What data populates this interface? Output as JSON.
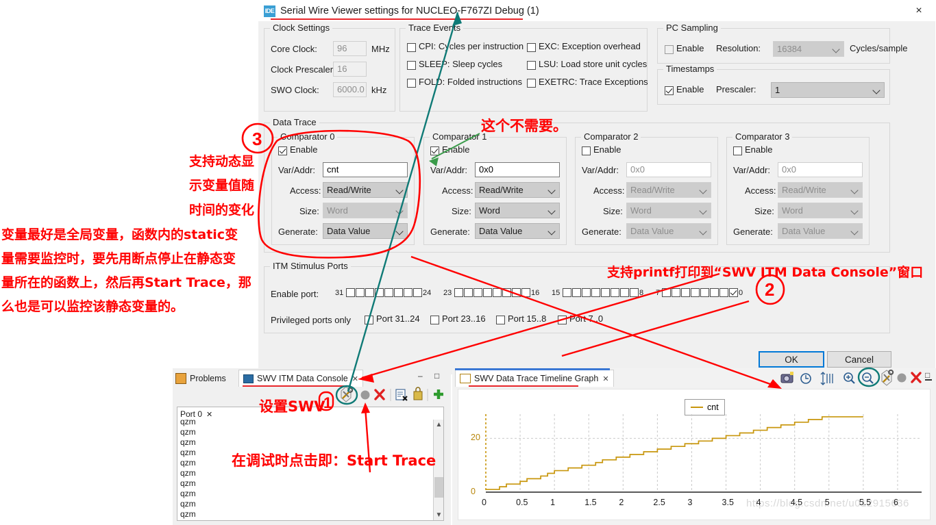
{
  "dialog": {
    "title": "Serial Wire Viewer settings for NUCLEO-F767ZI Debug (1)",
    "logo": "IDE",
    "close_icon": "×",
    "clock_settings": {
      "legend": "Clock Settings",
      "core_clock_label": "Core Clock:",
      "core_clock_value": "96",
      "core_clock_unit": "MHz",
      "prescaler_label": "Clock Prescaler:",
      "prescaler_value": "16",
      "swo_label": "SWO Clock:",
      "swo_value": "6000.0",
      "swo_unit": "kHz"
    },
    "trace_events": {
      "legend": "Trace Events",
      "items": [
        {
          "label": "CPI: Cycles per instruction",
          "checked": false
        },
        {
          "label": "SLEEP: Sleep cycles",
          "checked": false
        },
        {
          "label": "FOLD: Folded instructions",
          "checked": false
        },
        {
          "label": "EXC: Exception overhead",
          "checked": false
        },
        {
          "label": "LSU: Load store unit cycles",
          "checked": false
        },
        {
          "label": "EXETRC: Trace Exceptions",
          "checked": false
        }
      ]
    },
    "pc_sampling": {
      "legend": "PC Sampling",
      "enable_label": "Enable",
      "enable_checked": false,
      "resolution_label": "Resolution:",
      "resolution_value": "16384",
      "unit": "Cycles/sample"
    },
    "timestamps": {
      "legend": "Timestamps",
      "enable_label": "Enable",
      "enable_checked": true,
      "prescaler_label": "Prescaler:",
      "prescaler_value": "1"
    },
    "data_trace": {
      "legend": "Data Trace",
      "labels": {
        "enable": "Enable",
        "var": "Var/Addr:",
        "access": "Access:",
        "size": "Size:",
        "generate": "Generate:"
      },
      "comparators": [
        {
          "legend": "Comparator 0",
          "enabled": true,
          "var": "cnt",
          "access": "Read/Write",
          "size": "Word",
          "generate": "Data Value",
          "var_enabled": true,
          "access_enabled": true,
          "size_enabled": false,
          "generate_enabled": true
        },
        {
          "legend": "Comparator 1",
          "enabled": true,
          "var": "0x0",
          "access": "Read/Write",
          "size": "Word",
          "generate": "Data Value",
          "var_enabled": true,
          "access_enabled": true,
          "size_enabled": true,
          "generate_enabled": true
        },
        {
          "legend": "Comparator 2",
          "enabled": false,
          "var": "0x0",
          "access": "Read/Write",
          "size": "Word",
          "generate": "Data Value",
          "var_enabled": false,
          "access_enabled": false,
          "size_enabled": false,
          "generate_enabled": false
        },
        {
          "legend": "Comparator 3",
          "enabled": false,
          "var": "0x0",
          "access": "Read/Write",
          "size": "Word",
          "generate": "Data Value",
          "var_enabled": false,
          "access_enabled": false,
          "size_enabled": false,
          "generate_enabled": false
        }
      ]
    },
    "itm": {
      "legend": "ITM Stimulus Ports",
      "enable_port_label": "Enable port:",
      "groups": [
        {
          "hi": "31",
          "lo": "24",
          "checked": [
            false,
            false,
            false,
            false,
            false,
            false,
            false,
            false
          ]
        },
        {
          "hi": "23",
          "lo": "16",
          "checked": [
            false,
            false,
            false,
            false,
            false,
            false,
            false,
            false
          ]
        },
        {
          "hi": "15",
          "lo": "8",
          "checked": [
            false,
            false,
            false,
            false,
            false,
            false,
            false,
            false
          ]
        },
        {
          "hi": "7",
          "lo": "0",
          "checked": [
            false,
            false,
            false,
            false,
            false,
            false,
            false,
            true
          ]
        }
      ],
      "privileged_label": "Privileged ports only",
      "privileged": [
        {
          "label": "Port 31..24",
          "checked": false
        },
        {
          "label": "Port 23..16",
          "checked": false
        },
        {
          "label": "Port 15..8",
          "checked": false
        },
        {
          "label": "Port 7..0",
          "checked": false
        }
      ]
    },
    "buttons": {
      "ok": "OK",
      "cancel": "Cancel"
    }
  },
  "console_panel": {
    "tabs": [
      {
        "label": "Problems",
        "icon": "problems-icon",
        "selected": false
      },
      {
        "label": "SWV ITM Data Console",
        "icon": "console-icon",
        "selected": true
      }
    ],
    "toolbar": [
      {
        "name": "configure-swv-icon",
        "glyph": "swv-tools"
      },
      {
        "name": "start-trace-icon",
        "glyph": "record-dot"
      },
      {
        "name": "stop-trace-icon",
        "glyph": "red-x"
      },
      {
        "name": "clear-console-icon",
        "glyph": "clear"
      },
      {
        "name": "lock-scroll-icon",
        "glyph": "lock"
      },
      {
        "name": "new-console-icon",
        "glyph": "plus"
      }
    ],
    "minimize_icon": "–",
    "maximize_icon": "□",
    "port_tab": "Port 0",
    "port_tab_close": "✕",
    "lines": [
      "qzm",
      "qzm",
      "qzm",
      "qzm",
      "qzm",
      "qzm",
      "qzm",
      "qzm",
      "qzm",
      "qzm"
    ]
  },
  "graph_panel": {
    "tab_label": "SWV Data Trace Timeline Graph",
    "tab_icon": "graph-icon",
    "tab_close": "✕",
    "toolbar": [
      {
        "name": "screenshot-icon",
        "glyph": "camera"
      },
      {
        "name": "time-scale-icon",
        "glyph": "clock"
      },
      {
        "name": "vertical-scale-icon",
        "glyph": "updown-bars"
      },
      {
        "name": "zoom-in-icon",
        "glyph": "zoom-plus"
      },
      {
        "name": "zoom-out-icon",
        "glyph": "zoom-minus"
      },
      {
        "name": "configure-trace-icon",
        "glyph": "swv-tools"
      },
      {
        "name": "start-trace-icon",
        "glyph": "record-dot"
      },
      {
        "name": "stop-trace-icon",
        "glyph": "red-x"
      },
      {
        "name": "minimize-icon",
        "glyph": "–"
      },
      {
        "name": "maximize-icon",
        "glyph": "□"
      }
    ],
    "watermark": "https://blog.csdn.net/u012915636"
  },
  "chart_data": {
    "type": "line",
    "title": "",
    "xlabel": "",
    "ylabel": "",
    "legend": [
      "cnt"
    ],
    "legend_position": "top-center",
    "series_color": "#c8960c",
    "xlim": [
      0,
      6.35
    ],
    "ylim": [
      0,
      29
    ],
    "yticks": [
      0,
      20
    ],
    "xticks": [
      "0",
      "0.5",
      "1",
      "1.5",
      "2",
      "2.5",
      "3",
      "3.5",
      "4",
      "4.5",
      "5",
      "5.5",
      "6"
    ],
    "grid": true,
    "x": [
      0,
      0.1,
      0.2,
      0.3,
      0.4,
      0.5,
      0.6,
      0.7,
      0.8,
      0.9,
      1.0,
      1.1,
      1.2,
      1.3,
      1.4,
      1.5,
      1.6,
      1.7,
      1.8,
      1.9,
      2.0,
      2.1,
      2.2,
      2.3,
      2.4,
      2.5,
      2.6,
      2.7,
      2.8,
      2.9,
      3.0,
      3.1,
      3.2,
      3.3,
      3.4,
      3.5,
      3.6,
      3.7,
      3.8,
      3.9,
      4.0,
      4.1,
      4.2,
      4.3,
      4.4,
      4.5,
      4.6,
      4.7,
      4.8,
      4.9,
      5.0,
      5.1,
      5.2,
      5.3,
      5.4,
      5.5
    ],
    "values": [
      1,
      1,
      2,
      3,
      3,
      4,
      5,
      5,
      6,
      7,
      8,
      8,
      9,
      9,
      10,
      10,
      11,
      12,
      12,
      13,
      13,
      14,
      14,
      15,
      15,
      16,
      16,
      17,
      17,
      18,
      18,
      19,
      19,
      20,
      20,
      21,
      21,
      22,
      22,
      23,
      23,
      24,
      24,
      25,
      25,
      26,
      26,
      27,
      27,
      28,
      28,
      28,
      28,
      28,
      28,
      28
    ]
  },
  "annotations": {
    "a1": "这个不需要。",
    "a2": "支持动态显",
    "a3": "示变量值随",
    "a4": "时间的变化",
    "a5": "变量最好是全局变量，函数内的static变",
    "a6": "量需要监控时，要先用断点停止在静态变",
    "a7": "量所在的函数上，然后再Start Trace，那",
    "a8": "么也是可以监控该静态变量的。",
    "a9": "支持printf打印到“SWV ITM Data Console”窗口",
    "a10": "设置SWV",
    "a11": "在调试时点击即：Start Trace",
    "mark1": "1",
    "mark2": "2",
    "mark3": "3",
    "red": "#ff0000",
    "teal": "#0f7a76"
  }
}
